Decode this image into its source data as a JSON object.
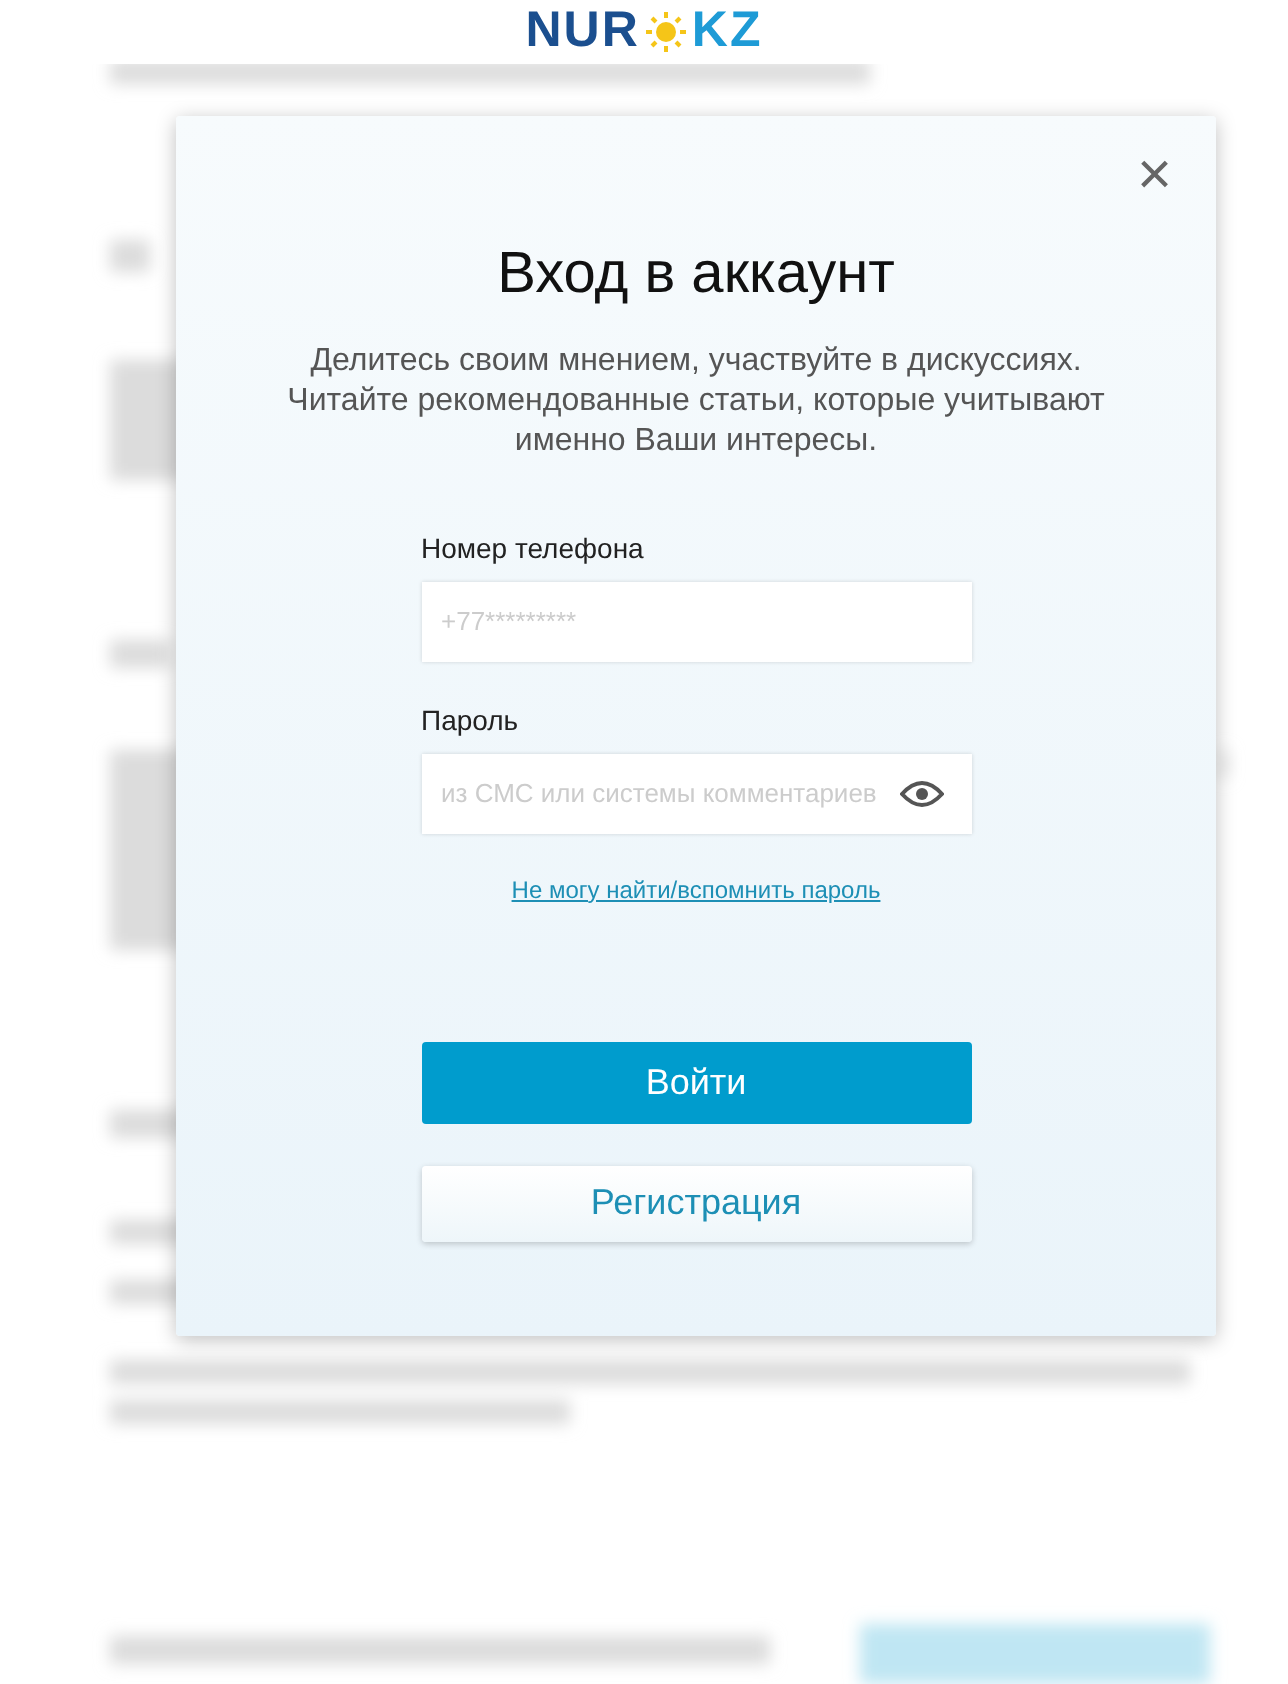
{
  "logo": {
    "left": "NUR",
    "right": "KZ"
  },
  "modal": {
    "close": "×",
    "title": "Вход в аккаунт",
    "subtitle": "Делитесь своим мнением, участвуйте в дискуссиях. Читайте рекомендованные статьи, которые учитывают именно Ваши интересы.",
    "fields": [
      {
        "kind": "text",
        "label": "Номер телефона",
        "placeholder": "+77*********"
      },
      {
        "kind": "password",
        "label": "Пароль",
        "placeholder": "из СМС или системы комментариев"
      }
    ],
    "forgot_link": "Не могу найти/вспомнить пароль",
    "buttons": [
      {
        "kind": "primary",
        "label": "Войти"
      },
      {
        "kind": "secondary",
        "label": "Регистрация"
      }
    ]
  }
}
